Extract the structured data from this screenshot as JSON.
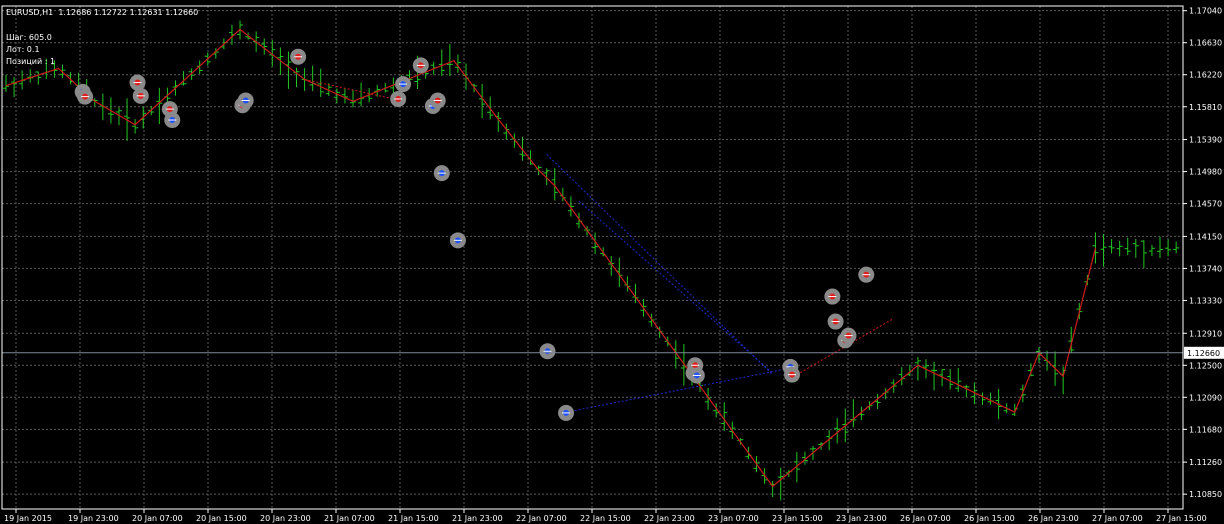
{
  "header": {
    "symbol": "EURUSD,H1",
    "ohlc": "1.12686 1.12722 1.12631 1.12660"
  },
  "info": {
    "step": "Шаг: 605.0",
    "lot": "Лот: 0.1",
    "positions": "Позиций : 1"
  },
  "colors": {
    "background": "#000000",
    "grid": "#5a5a5a",
    "candle": "#22c822",
    "zigzag": "#d11a1a",
    "trend_blue": "#1c2cc8",
    "bid_line": "#7e8898",
    "axis": "#ffffff",
    "marker_bg": "#8a8a8a",
    "marker_bull": "#1e50ff",
    "marker_bear": "#e01e1e",
    "dash_yellow": "#e8d800"
  },
  "chart_data": {
    "type": "line",
    "title": "",
    "xlabel": "",
    "ylabel": "",
    "ylim": [
      1.1066,
      1.171
    ],
    "grid": true,
    "price_ticks": [
      "1.17040",
      "1.16630",
      "1.16220",
      "1.15810",
      "1.15390",
      "1.14980",
      "1.14570",
      "1.14150",
      "1.13740",
      "1.13330",
      "1.12910",
      "1.12500",
      "1.12090",
      "1.11680",
      "1.11260",
      "1.10850"
    ],
    "current_price": "1.12660",
    "time_ticks": [
      "19 Jan 2015",
      "19 Jan 23:00",
      "20 Jan 07:00",
      "20 Jan 15:00",
      "20 Jan 23:00",
      "21 Jan 07:00",
      "21 Jan 15:00",
      "21 Jan 23:00",
      "22 Jan 07:00",
      "22 Jan 15:00",
      "22 Jan 23:00",
      "23 Jan 07:00",
      "23 Jan 15:00",
      "23 Jan 23:00",
      "26 Jan 07:00",
      "26 Jan 15:00",
      "26 Jan 23:00",
      "27 Jan 07:00",
      "27 Jan 15:00"
    ],
    "series": [
      {
        "kind": "zigzag",
        "x_bar": [
          0,
          6.5,
          11,
          16,
          29,
          37,
          43,
          55.5,
          61,
          66,
          68,
          95,
          113,
          125,
          128,
          131,
          135
        ],
        "y": [
          1.1608,
          1.163,
          1.1588,
          1.1558,
          1.168,
          1.1616,
          1.1588,
          1.164,
          1.1565,
          1.15,
          1.148,
          1.1095,
          1.125,
          1.119,
          1.1266,
          1.1236,
          1.14
        ]
      }
    ],
    "markers": [
      {
        "bar": 9.5,
        "price": 1.16,
        "dir": "bull"
      },
      {
        "bar": 9.8,
        "price": 1.1594,
        "dir": "bear"
      },
      {
        "bar": 16.3,
        "price": 1.1612,
        "dir": "bear"
      },
      {
        "bar": 16.7,
        "price": 1.1595,
        "dir": "bear"
      },
      {
        "bar": 20.3,
        "price": 1.1578,
        "dir": "bear"
      },
      {
        "bar": 20.6,
        "price": 1.1564,
        "dir": "bull"
      },
      {
        "bar": 29.3,
        "price": 1.1583,
        "dir": "bear"
      },
      {
        "bar": 29.7,
        "price": 1.1589,
        "dir": "bull"
      },
      {
        "bar": 36.2,
        "price": 1.1645,
        "dir": "bear"
      },
      {
        "bar": 48.6,
        "price": 1.1591,
        "dir": "bear"
      },
      {
        "bar": 49.2,
        "price": 1.161,
        "dir": "bull"
      },
      {
        "bar": 51.4,
        "price": 1.1634,
        "dir": "bear"
      },
      {
        "bar": 52.9,
        "price": 1.1582,
        "dir": "bull"
      },
      {
        "bar": 53.5,
        "price": 1.1589,
        "dir": "bear"
      },
      {
        "bar": 54.0,
        "price": 1.1496,
        "dir": "bull"
      },
      {
        "bar": 56.0,
        "price": 1.141,
        "dir": "bull"
      },
      {
        "bar": 67.1,
        "price": 1.1268,
        "dir": "bull"
      },
      {
        "bar": 69.4,
        "price": 1.1189,
        "dir": "bull"
      },
      {
        "bar": 85.2,
        "price": 1.124,
        "dir": "bear"
      },
      {
        "bar": 85.4,
        "price": 1.125,
        "dir": "bear"
      },
      {
        "bar": 85.6,
        "price": 1.1237,
        "dir": "bull"
      },
      {
        "bar": 97.2,
        "price": 1.1248,
        "dir": "bull"
      },
      {
        "bar": 97.4,
        "price": 1.1238,
        "dir": "bear"
      },
      {
        "bar": 102.4,
        "price": 1.1338,
        "dir": "bear"
      },
      {
        "bar": 102.8,
        "price": 1.1306,
        "dir": "bear"
      },
      {
        "bar": 104.0,
        "price": 1.1282,
        "dir": "bear"
      },
      {
        "bar": 104.4,
        "price": 1.1288,
        "dir": "bear"
      },
      {
        "bar": 106.6,
        "price": 1.1366,
        "dir": "bear"
      }
    ]
  }
}
